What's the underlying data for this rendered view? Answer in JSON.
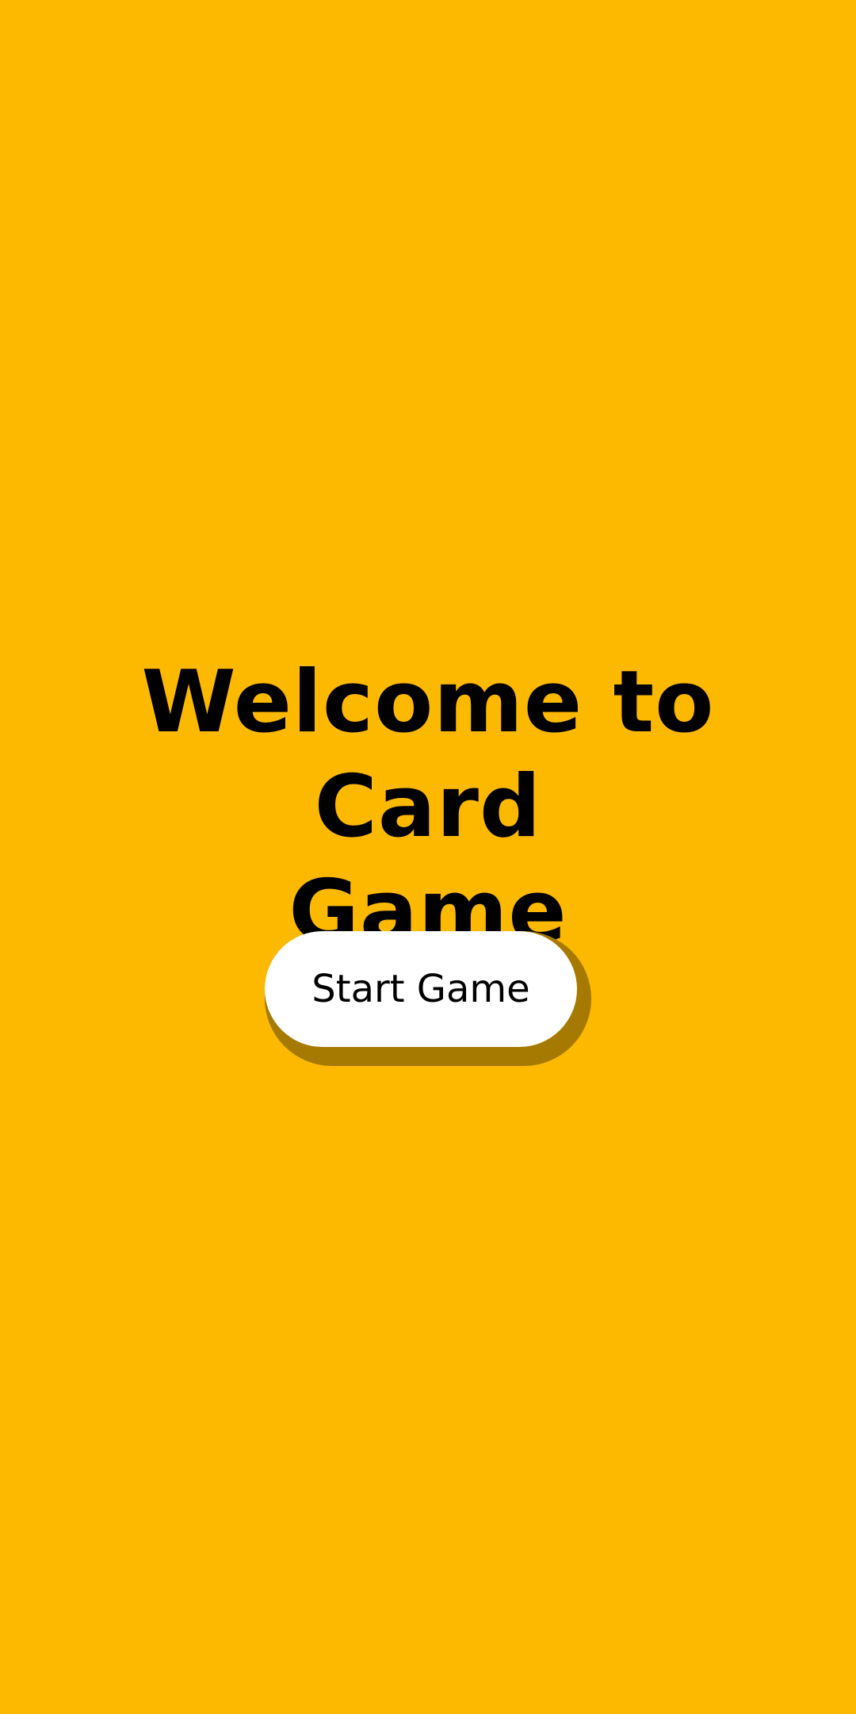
{
  "welcome": {
    "title_line1": "Welcome to Card",
    "title_line2": "Game",
    "start_button_label": "Start Game"
  },
  "colors": {
    "background": "#FDB800",
    "button_bg": "#FFFFFF",
    "button_shadow": "#A67A00",
    "text": "#000000"
  }
}
